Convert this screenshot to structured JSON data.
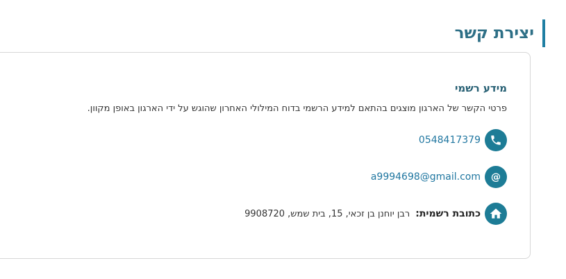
{
  "section": {
    "title": "יצירת קשר"
  },
  "card": {
    "heading": "מידע רשמי",
    "description": "פרטי הקשר של הארגון מוצגים בהתאם למידע הרשמי בדוח המילולי האחרון שהוגש על ידי הארגון באופן מקוון.",
    "phone": "0548417379",
    "email": "a9994698@gmail.com",
    "address_label": "כתובת רשמית:",
    "address_value": "רבן יוחנן בן זכאי, 15, בית שמש, 9908720"
  },
  "icons": {
    "phone": "phone-icon",
    "email": "at-sign-icon",
    "address": "home-icon"
  },
  "colors": {
    "accent": "#1d7c96",
    "title": "#2d6f86",
    "link": "#1f76a0"
  }
}
